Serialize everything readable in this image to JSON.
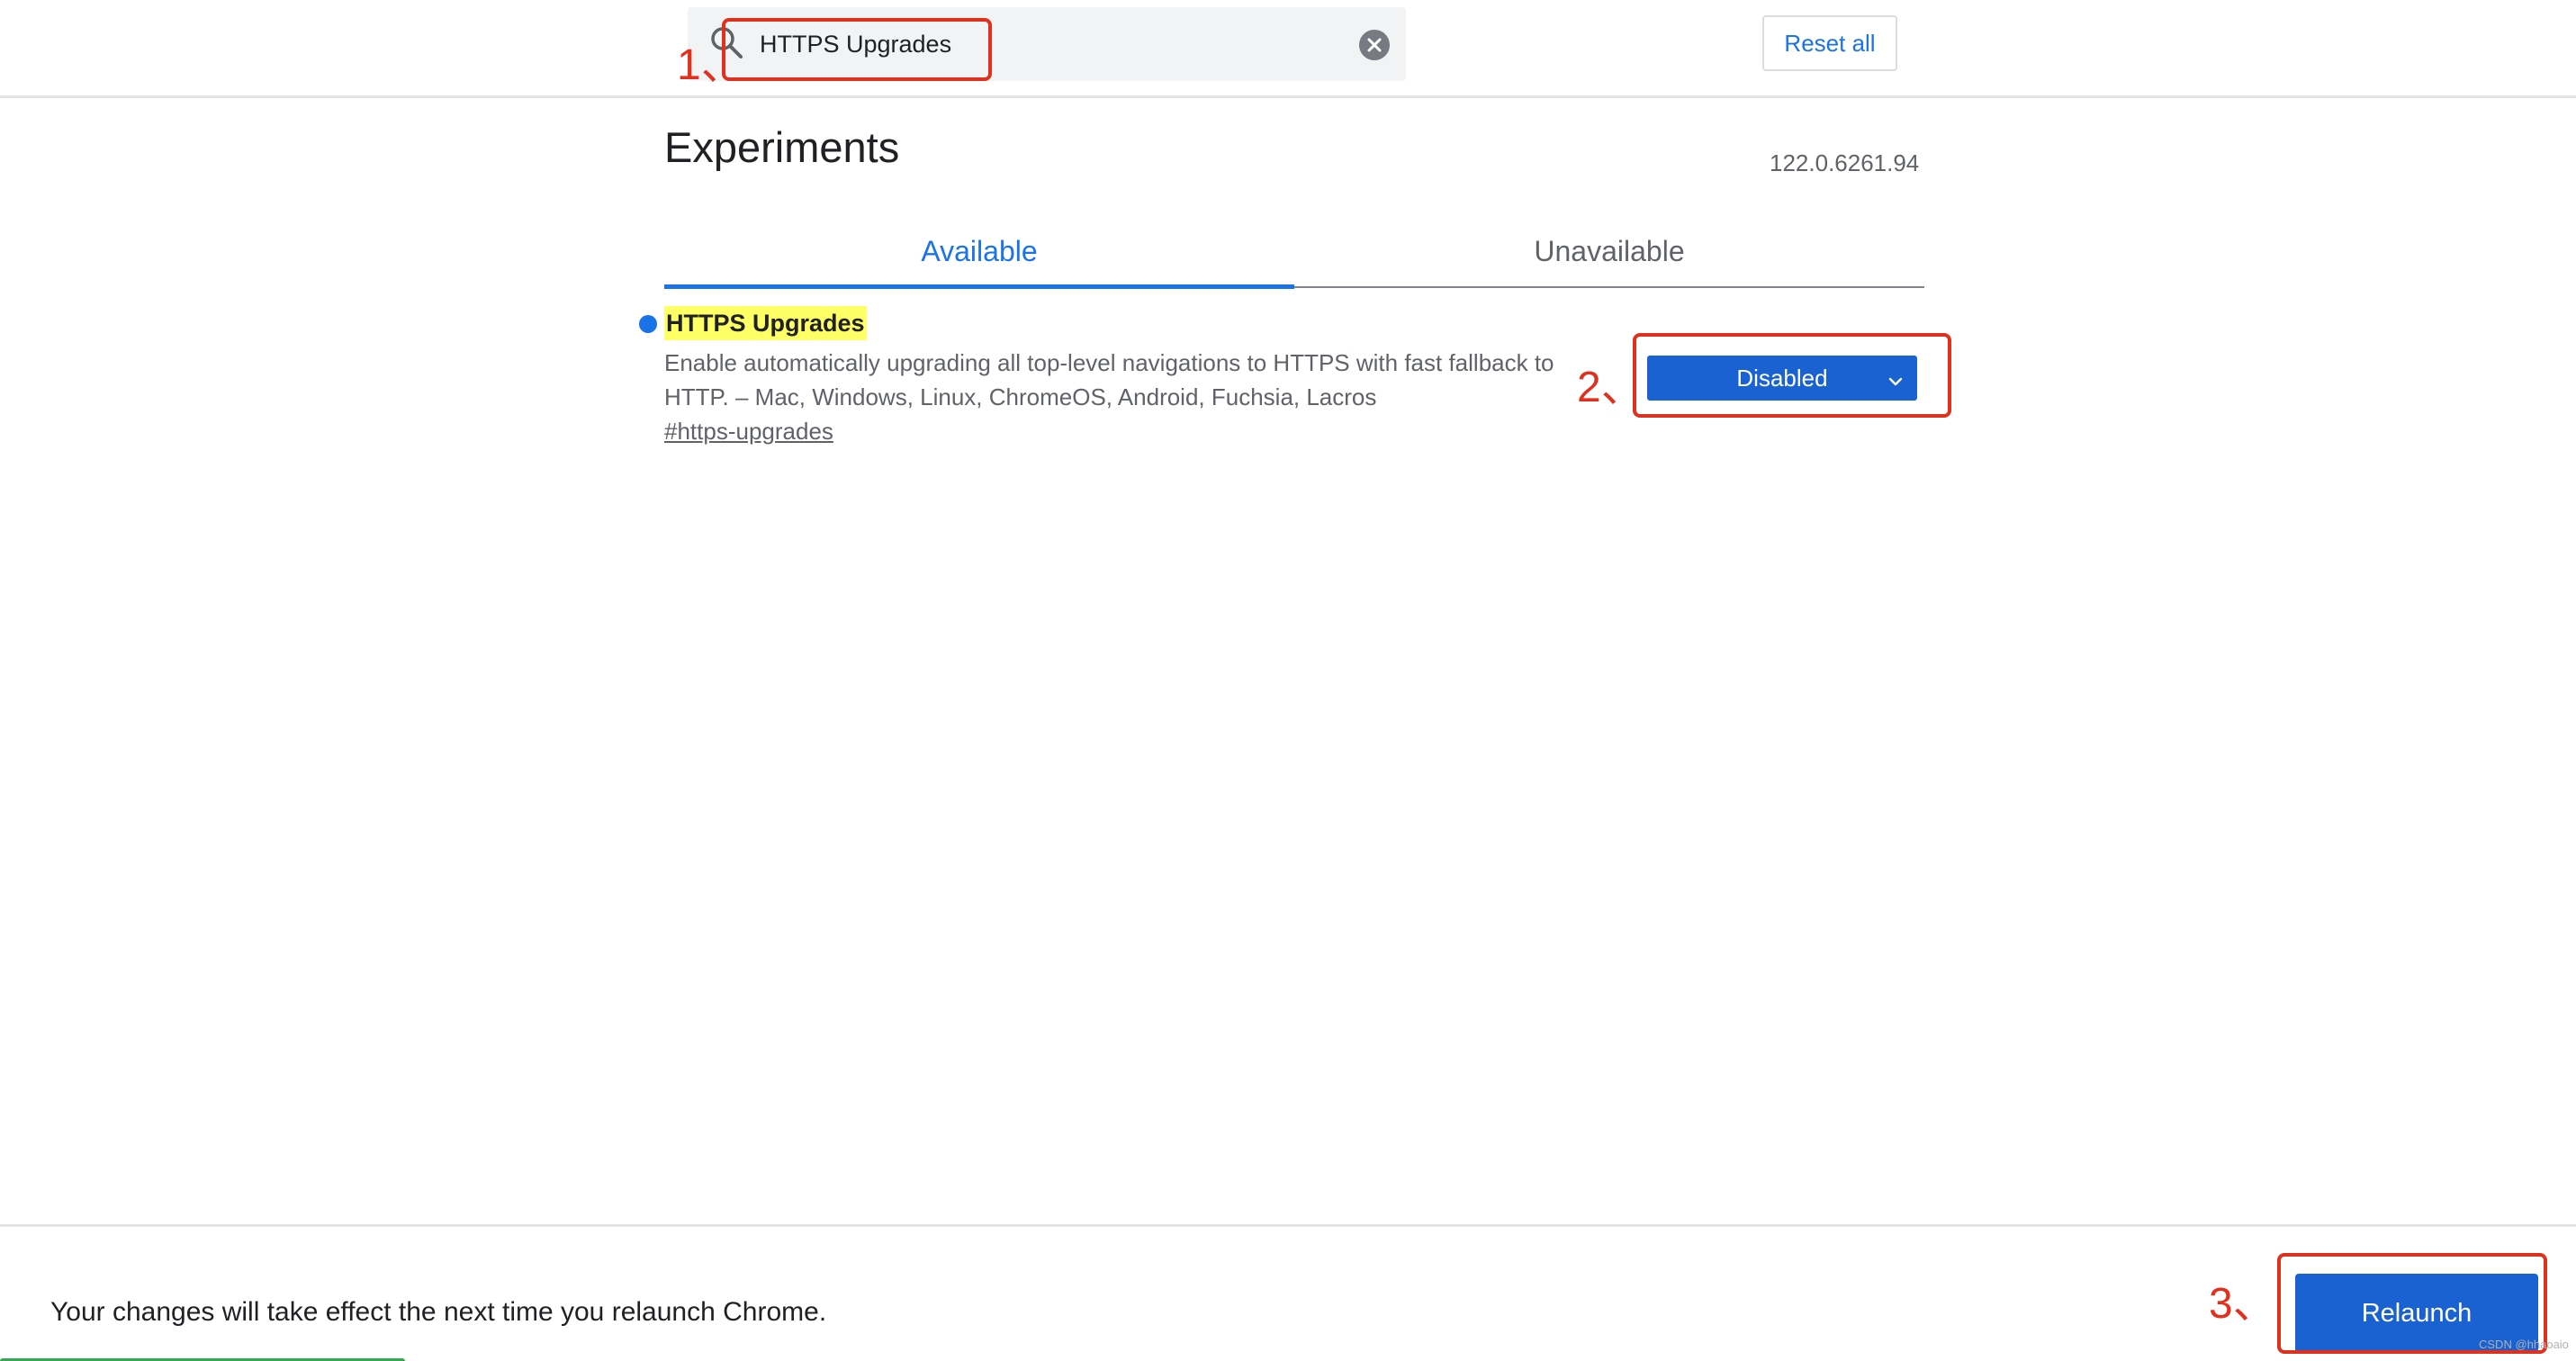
{
  "header": {
    "search_value": "HTTPS Upgrades",
    "reset_label": "Reset all"
  },
  "main": {
    "title": "Experiments",
    "version": "122.0.6261.94",
    "tabs": [
      {
        "label": "Available",
        "active": true
      },
      {
        "label": "Unavailable",
        "active": false
      }
    ],
    "flag": {
      "name": "HTTPS Upgrades",
      "description": "Enable automatically upgrading all top-level navigations to HTTPS with fast fallback to HTTP. – Mac, Windows, Linux, ChromeOS, Android, Fuchsia, Lacros",
      "link": "#https-upgrades",
      "state": "Disabled"
    }
  },
  "footer": {
    "message": "Your changes will take effect the next time you relaunch Chrome.",
    "relaunch_label": "Relaunch"
  },
  "annotations": {
    "step1": "1、",
    "step2": "2、",
    "step3": "3、"
  },
  "watermark": "CSDN @hhaoaio",
  "colors": {
    "accent": "#1a73e8",
    "button_fill": "#1a62d1",
    "highlight": "#ffff66",
    "annotation_red": "#e0301e"
  },
  "icons": {
    "search": "search-icon",
    "clear": "clear-icon",
    "dropdown": "chevron-down-icon"
  }
}
